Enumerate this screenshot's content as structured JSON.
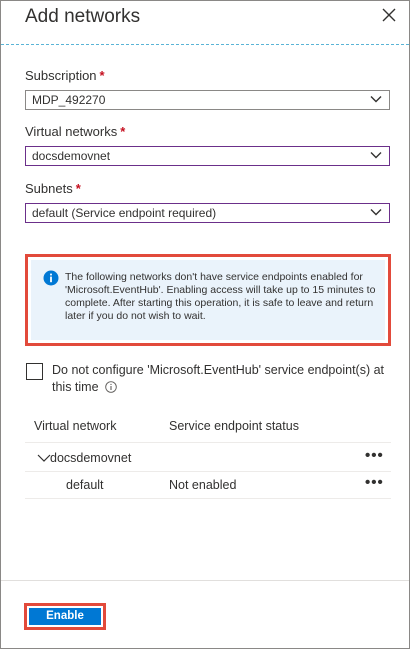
{
  "header": {
    "title": "Add networks"
  },
  "form": {
    "subscription": {
      "label": "Subscription",
      "required_mark": "*",
      "value": "MDP_492270"
    },
    "virtual_networks": {
      "label": "Virtual networks",
      "required_mark": "*",
      "value": "docsdemovnet"
    },
    "subnets": {
      "label": "Subnets",
      "required_mark": "*",
      "value": "default (Service endpoint required)"
    }
  },
  "info_banner": {
    "text": "The following networks don't have service endpoints enabled for 'Microsoft.EventHub'. Enabling access will take up to 15 minutes to complete. After starting this operation, it is safe to leave and return later if you do not wish to wait."
  },
  "checkbox": {
    "label": "Do not configure 'Microsoft.EventHub' service endpoint(s) at this time",
    "checked": false
  },
  "table": {
    "headers": [
      "Virtual network",
      "Service endpoint status"
    ],
    "rows": [
      {
        "network": "docsdemovnet",
        "status": "",
        "more": "•••"
      },
      {
        "network": "default",
        "status": "Not enabled",
        "more": "•••"
      }
    ]
  },
  "footer": {
    "enable_label": "Enable"
  },
  "colors": {
    "accent": "#0078d4",
    "highlight_border": "#e24a3b",
    "required": "#c50f1f",
    "info_bg": "#eaf3fb"
  }
}
